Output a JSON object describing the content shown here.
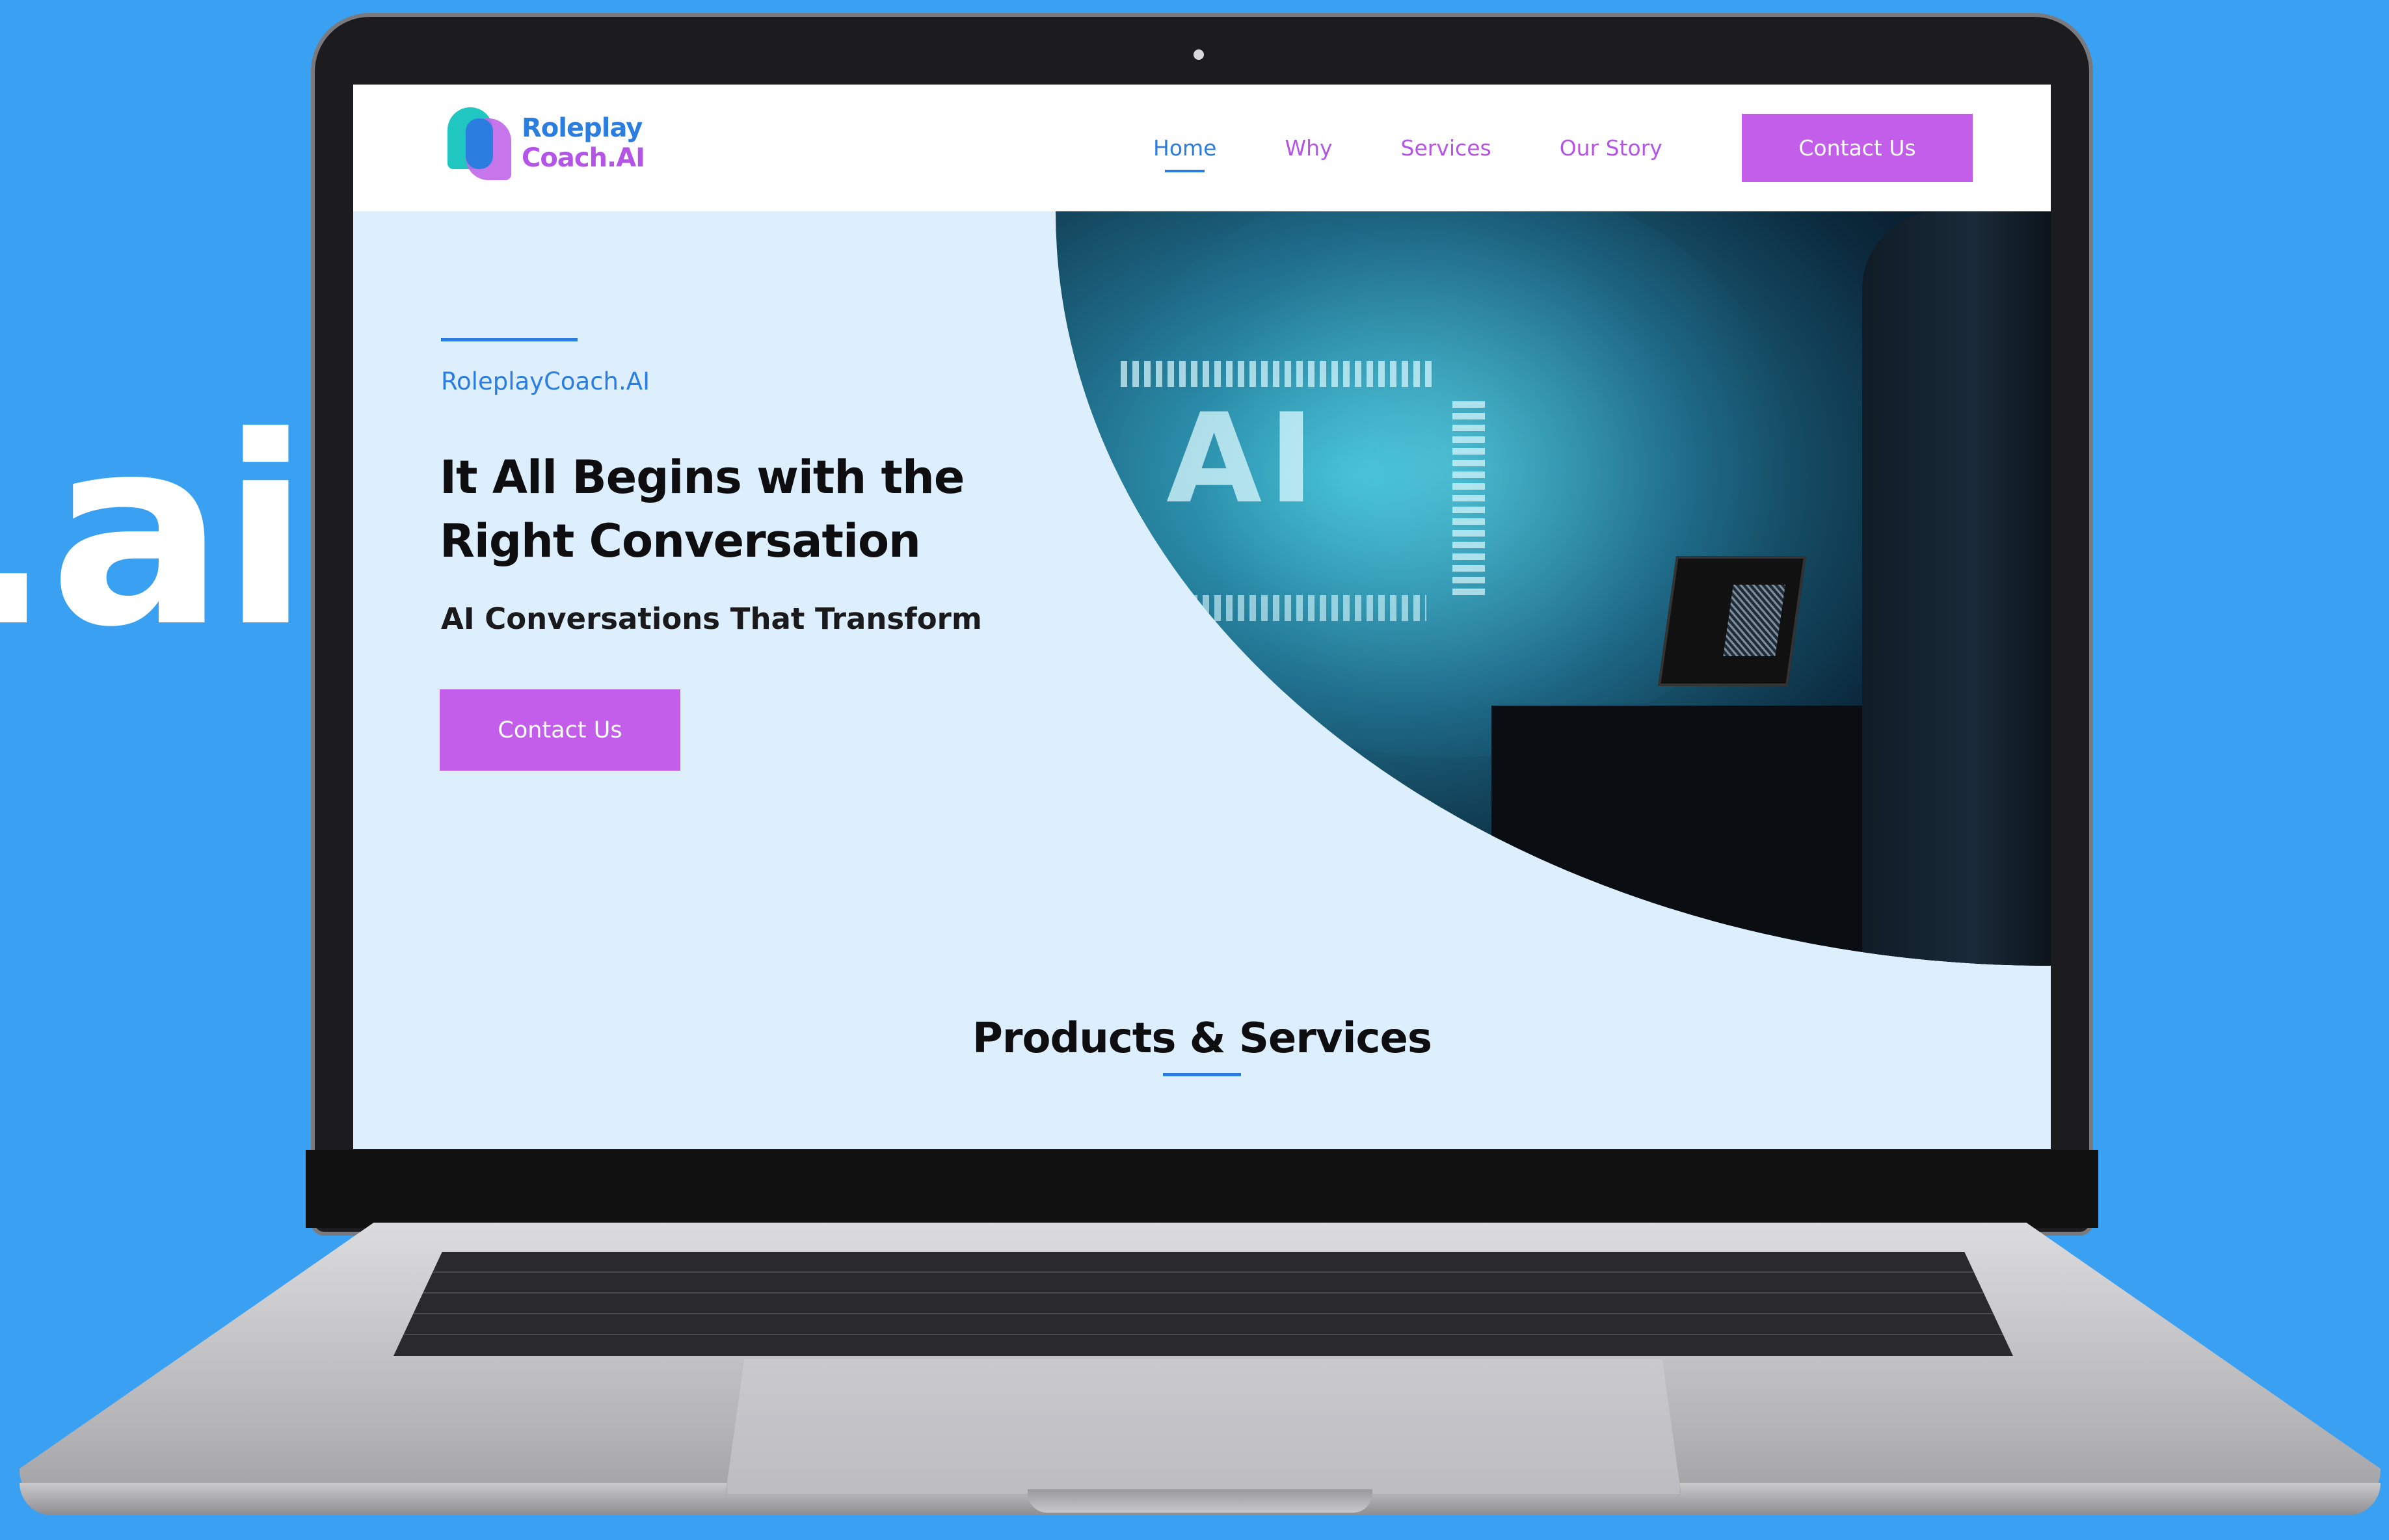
{
  "background_text": ".ai",
  "colors": {
    "background": "#3aa0f1",
    "accent_purple": "#c25ee9",
    "accent_blue": "#2c7de0",
    "hero_bg": "#ddeefd"
  },
  "nav": {
    "logo": {
      "line1": "Roleplay",
      "line2": "Coach.AI"
    },
    "items": [
      {
        "label": "Home",
        "active": true
      },
      {
        "label": "Why",
        "active": false
      },
      {
        "label": "Services",
        "active": false
      },
      {
        "label": "Our Story",
        "active": false
      }
    ],
    "cta_label": "Contact Us"
  },
  "hero": {
    "brand": "RoleplayCoach.AI",
    "headline": "It All Begins with the Right Conversation",
    "subheadline": "AI Conversations That Transform",
    "cta_label": "Contact Us",
    "image_text": "AI"
  },
  "section": {
    "title": "Products & Services"
  }
}
